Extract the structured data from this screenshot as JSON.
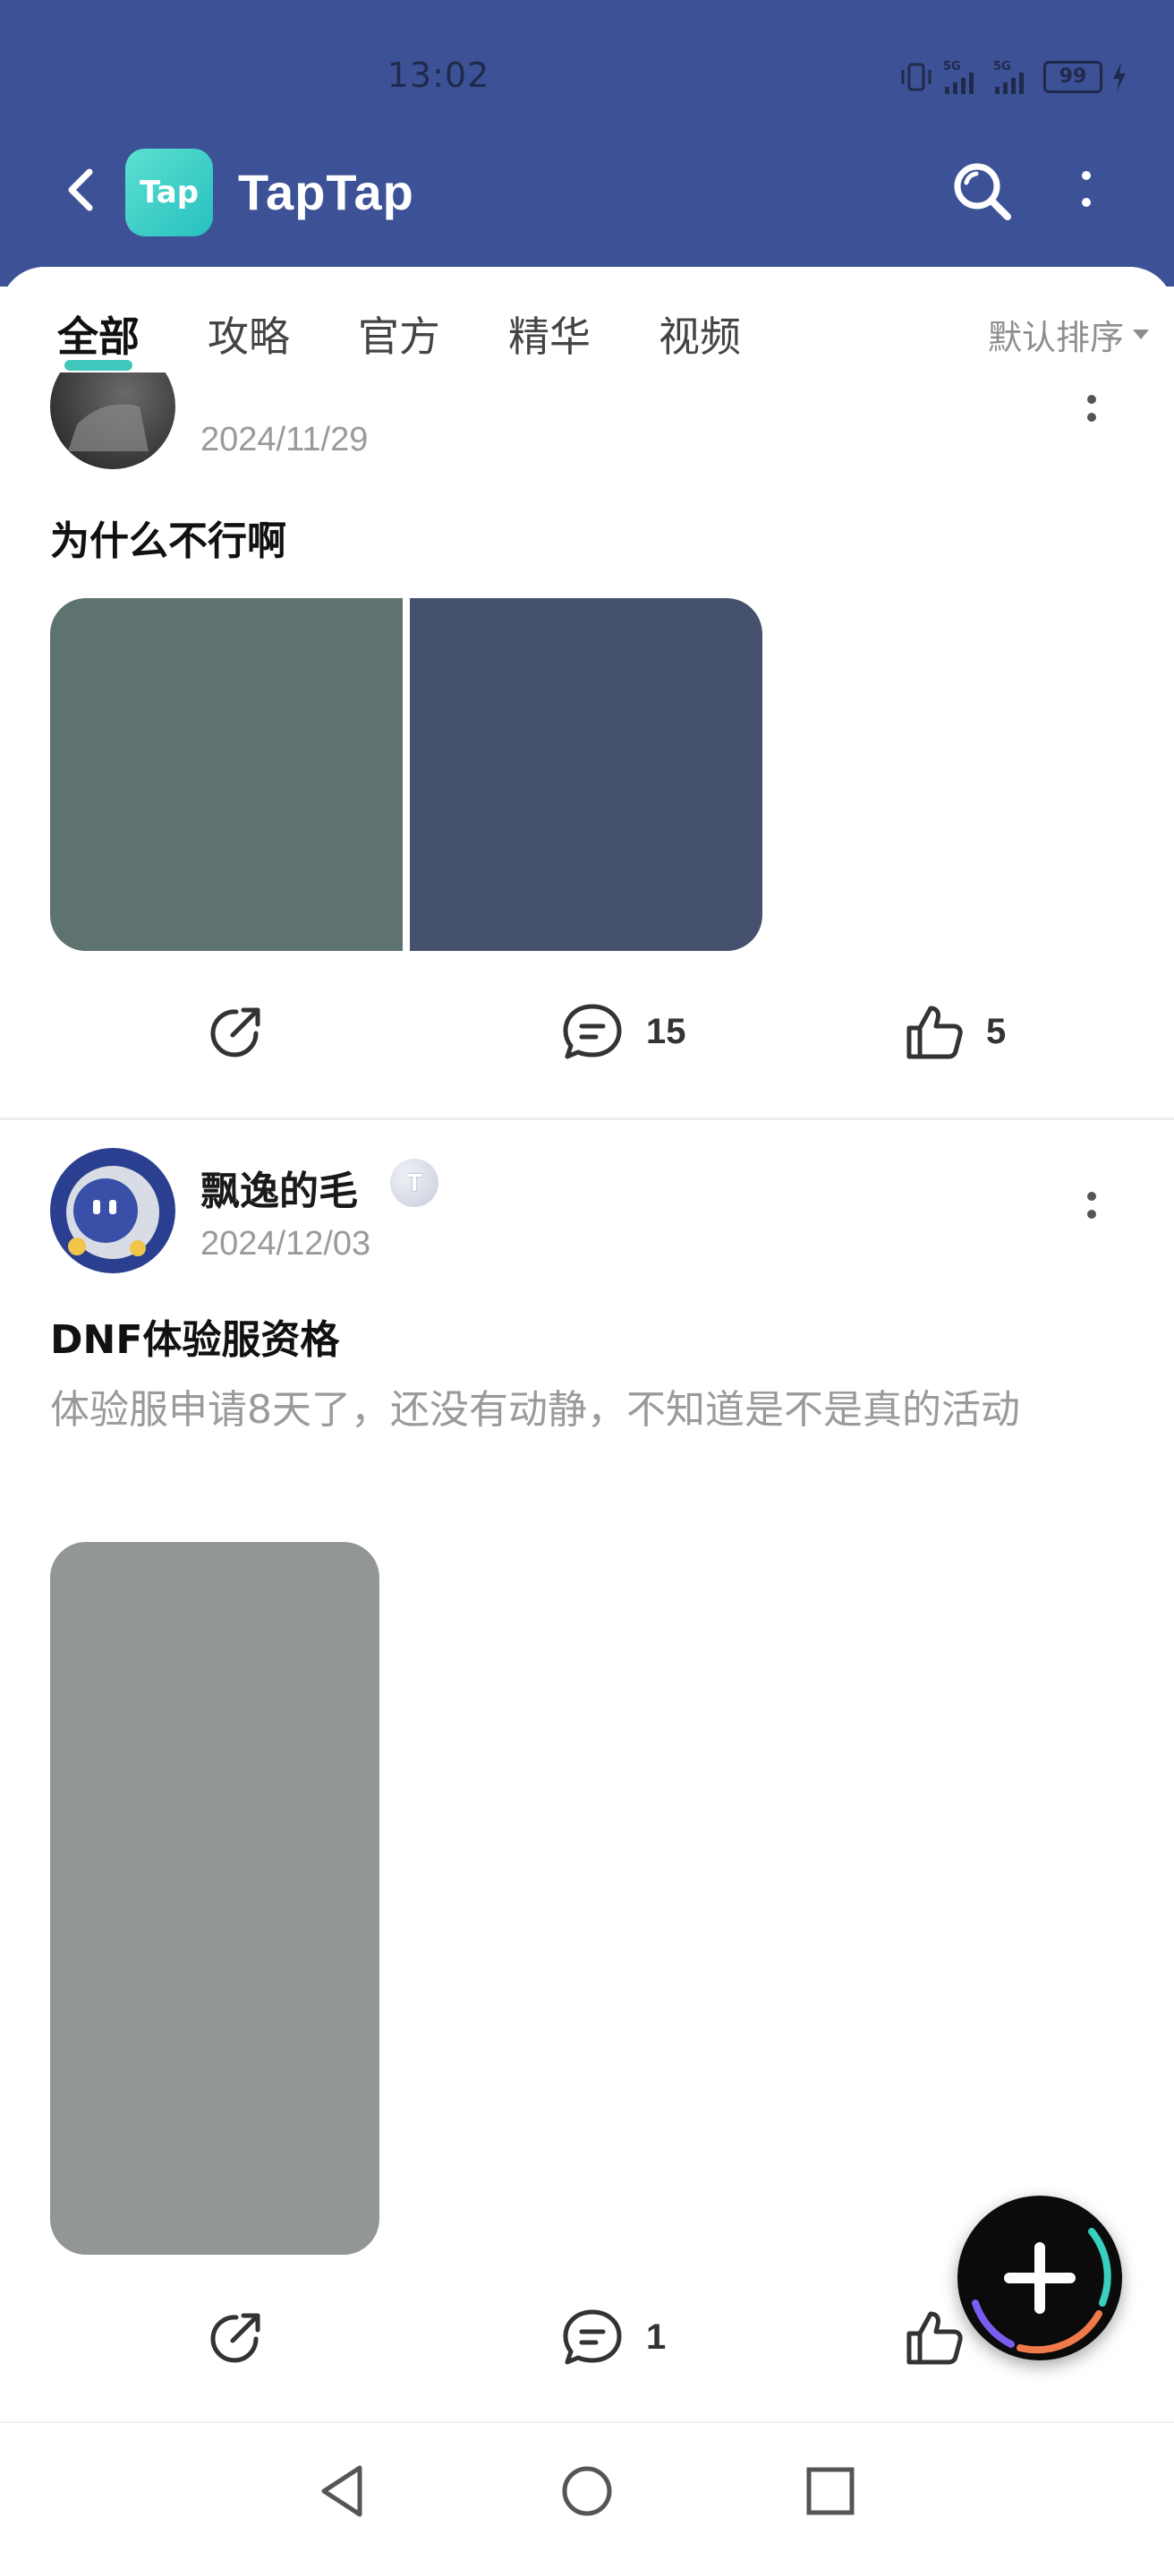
{
  "status_bar": {
    "time": "13:02",
    "battery": "99",
    "signal_label_1": "5G",
    "signal_label_2": "5G"
  },
  "app_bar": {
    "logo_text": "Tap",
    "title": "TapTap"
  },
  "tabs": [
    {
      "label": "全部",
      "active": true
    },
    {
      "label": "攻略",
      "active": false
    },
    {
      "label": "官方",
      "active": false
    },
    {
      "label": "精华",
      "active": false
    },
    {
      "label": "视频",
      "active": false
    }
  ],
  "sort": {
    "label": "默认排序"
  },
  "posts": [
    {
      "date": "2024/11/29",
      "title": "为什么不行啊",
      "images": [
        {
          "color": "#5e7370"
        },
        {
          "color": "#46516e"
        }
      ],
      "comments": "15",
      "likes": "5"
    },
    {
      "user": "飘逸的毛",
      "badge": "T",
      "date": "2024/12/03",
      "title": "DNF体验服资格",
      "body": "体验服申请8天了，还没有动静，不知道是不是真的活动",
      "images": [
        {
          "color": "#939696"
        }
      ],
      "comments": "1"
    }
  ],
  "colors": {
    "header": "#3d5196",
    "accent": "#2bc2b5"
  },
  "icons": [
    "back-arrow-icon",
    "search-icon",
    "more-vertical-icon",
    "share-icon",
    "comment-icon",
    "thumbs-up-icon",
    "plus-icon",
    "nav-back-icon",
    "nav-home-icon",
    "nav-recents-icon"
  ]
}
